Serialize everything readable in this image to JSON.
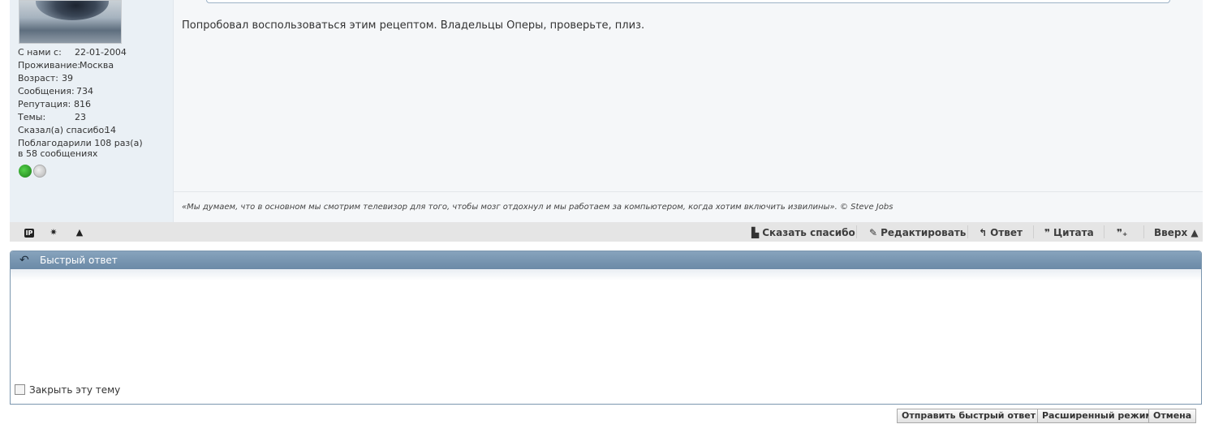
{
  "user": {
    "fields": [
      {
        "label": "С нами с:",
        "value": "22-01-2004"
      },
      {
        "label": "Проживание:",
        "value": "Москва"
      },
      {
        "label": "Возраст:",
        "value": "39"
      },
      {
        "label": "Сообщения:",
        "value": "734"
      },
      {
        "label": "Репутация:",
        "value": "816"
      },
      {
        "label": "Темы:",
        "value": "23"
      },
      {
        "label": "Сказал(а) спасибо:",
        "value": "14"
      }
    ],
    "thanked_line1": "Поблагодарили 108 раз(а)",
    "thanked_line2": "в 58 сообщениях",
    "badges": [
      "clover-icon",
      "grey-badge-icon"
    ]
  },
  "post": {
    "message": "Попробовал воспользоваться этим рецептом. Владельцы Оперы, проверьте, плиз.",
    "signature": "«Мы думаем, что в основном мы смотрим телевизор для того, чтобы мозг отдохнул и мы работаем за компьютером, когда хотим включить извилины». © Steve Jobs"
  },
  "postbar": {
    "ip_label": "IP",
    "thanks": "Сказать спасибо",
    "edit": "Редактировать",
    "reply": "Ответ",
    "quote": "Цитата",
    "multiquote": "",
    "top": "Вверх ▲"
  },
  "quick_reply": {
    "title": "Быстрый ответ",
    "close_topic": "Закрыть эту тему",
    "submit": "Отправить быстрый ответ",
    "advanced": "Расширенный режим",
    "cancel": "Отмена"
  },
  "colors": {
    "header": "#7593b0",
    "post_bg": "#f5f7f9",
    "userinfo_bg": "#eaf0f5",
    "postbar_bg": "#e5e5e5"
  }
}
